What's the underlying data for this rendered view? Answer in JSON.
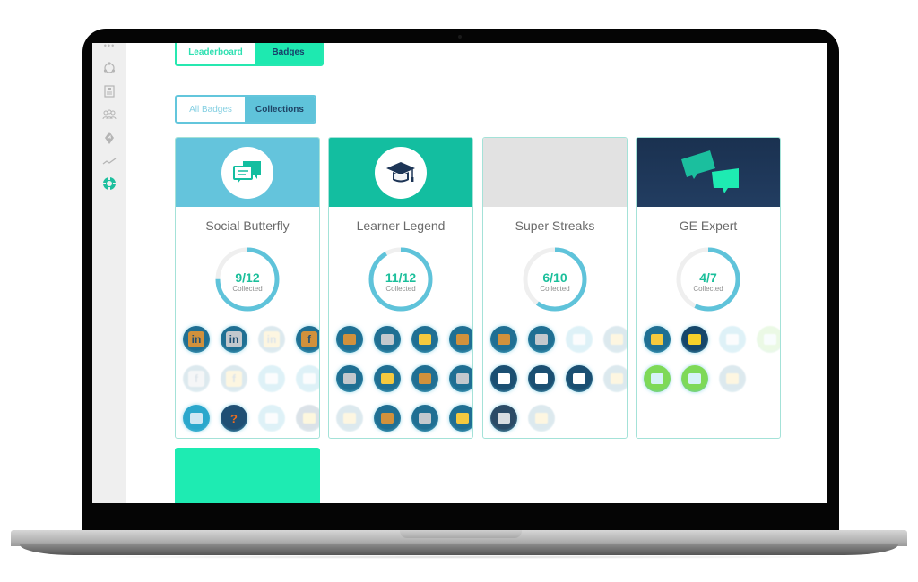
{
  "tabs": {
    "main": [
      {
        "label": "Leaderboard",
        "active": false
      },
      {
        "label": "Badges",
        "active": true
      }
    ],
    "sub": [
      {
        "label": "All Badges",
        "active": false
      },
      {
        "label": "Collections",
        "active": true
      }
    ]
  },
  "sidebar": {
    "items": [
      {
        "icon": "more-dots-icon"
      },
      {
        "icon": "network-icon"
      },
      {
        "icon": "clipboard-icon"
      },
      {
        "icon": "team-icon"
      },
      {
        "icon": "directions-icon"
      },
      {
        "icon": "trend-line-icon"
      },
      {
        "icon": "lifebuoy-icon",
        "active": true
      }
    ]
  },
  "colors": {
    "accent_green": "#1ee9b0",
    "accent_blue": "#5fc3da",
    "ring_progress": "#5fc3da",
    "ring_track": "#efefef",
    "count_text": "#1bbf9b",
    "card_border": "#a4e2d8"
  },
  "collections": [
    {
      "title": "Social Butterfly",
      "banner_color": "#64c4dc",
      "banner_icon": "chat-bubbles-icon",
      "collected": 9,
      "total": 12,
      "count_label": "9/12",
      "sub_label": "Collected",
      "badges": [
        {
          "icon": "linkedin-bronze-icon",
          "text": "in",
          "unlocked": true
        },
        {
          "icon": "linkedin-silver-icon",
          "text": "in",
          "unlocked": true
        },
        {
          "icon": "linkedin-gold-icon",
          "text": "in",
          "unlocked": false
        },
        {
          "icon": "facebook-bronze-icon",
          "text": "f",
          "unlocked": true
        },
        {
          "icon": "facebook-silver-icon",
          "text": "f",
          "unlocked": false
        },
        {
          "icon": "facebook-gold-icon",
          "text": "f",
          "unlocked": false
        },
        {
          "icon": "link-icon",
          "text": "",
          "unlocked": false
        },
        {
          "icon": "storefront-icon",
          "text": "",
          "unlocked": false
        },
        {
          "icon": "monitor-pencil-icon",
          "text": "",
          "unlocked": true
        },
        {
          "icon": "question-bubble-icon",
          "text": "?",
          "unlocked": true
        },
        {
          "icon": "trophy-person-icon",
          "text": "",
          "unlocked": false
        },
        {
          "icon": "stars-icon",
          "text": "",
          "unlocked": false
        }
      ]
    },
    {
      "title": "Learner Legend",
      "banner_color": "#13bea0",
      "banner_icon": "graduation-cap-icon",
      "collected": 11,
      "total": 12,
      "count_label": "11/12",
      "sub_label": "Collected",
      "badges": [
        {
          "icon": "monitor-download-bronze-icon",
          "text": "",
          "unlocked": true
        },
        {
          "icon": "monitor-download-silver-icon",
          "text": "",
          "unlocked": true
        },
        {
          "icon": "monitor-download-gold-icon",
          "text": "",
          "unlocked": true
        },
        {
          "icon": "monitor-shirt-bronze-icon",
          "text": "",
          "unlocked": true
        },
        {
          "icon": "monitor-shirt-silver-icon",
          "text": "",
          "unlocked": true
        },
        {
          "icon": "monitor-shirt-gold-icon",
          "text": "",
          "unlocked": true
        },
        {
          "icon": "clipboard-trophy-bronze-icon",
          "text": "",
          "unlocked": true
        },
        {
          "icon": "clipboard-trophy-silver-icon",
          "text": "",
          "unlocked": true
        },
        {
          "icon": "clipboard-trophy-gold-icon",
          "text": "",
          "unlocked": false
        },
        {
          "icon": "paper-pencil-bronze-icon",
          "text": "",
          "unlocked": true
        },
        {
          "icon": "paper-pencil-silver-icon",
          "text": "",
          "unlocked": true
        },
        {
          "icon": "paper-pencil-gold-icon",
          "text": "",
          "unlocked": true
        }
      ]
    },
    {
      "title": "Super Streaks",
      "banner_color": "#e2e2e2",
      "banner_icon": "",
      "collected": 6,
      "total": 10,
      "count_label": "6/10",
      "sub_label": "Collected",
      "badges": [
        {
          "icon": "key-bronze-icon",
          "text": "",
          "unlocked": true
        },
        {
          "icon": "key-silver-icon",
          "text": "",
          "unlocked": true
        },
        {
          "icon": "key-white-icon",
          "text": "",
          "unlocked": false
        },
        {
          "icon": "key-gold-icon",
          "text": "",
          "unlocked": false
        },
        {
          "icon": "podium-icon",
          "text": "",
          "unlocked": true
        },
        {
          "icon": "podium-right-icon",
          "text": "",
          "unlocked": true
        },
        {
          "icon": "podium-left-icon",
          "text": "",
          "unlocked": true
        },
        {
          "icon": "podium-gold-icon",
          "text": "",
          "unlocked": false
        },
        {
          "icon": "camera-icon",
          "text": "",
          "unlocked": true
        },
        {
          "icon": "photo-gold-icon",
          "text": "",
          "unlocked": false
        }
      ]
    },
    {
      "title": "GE Expert",
      "banner_color": "#1d3556",
      "banner_icon": "speech-bubbles-icon",
      "collected": 4,
      "total": 7,
      "count_label": "4/7",
      "sub_label": "Collected",
      "badges": [
        {
          "icon": "sunrise-icon",
          "text": "",
          "unlocked": true
        },
        {
          "icon": "night-stars-icon",
          "text": "",
          "unlocked": true
        },
        {
          "icon": "owl-icon",
          "text": "",
          "unlocked": false
        },
        {
          "icon": "robot-sad-icon",
          "text": "",
          "unlocked": false
        },
        {
          "icon": "robot-happy-icon",
          "text": "",
          "unlocked": true
        },
        {
          "icon": "robot-wink-icon",
          "text": "",
          "unlocked": true
        },
        {
          "icon": "sun-face-icon",
          "text": "",
          "unlocked": false
        }
      ]
    }
  ]
}
